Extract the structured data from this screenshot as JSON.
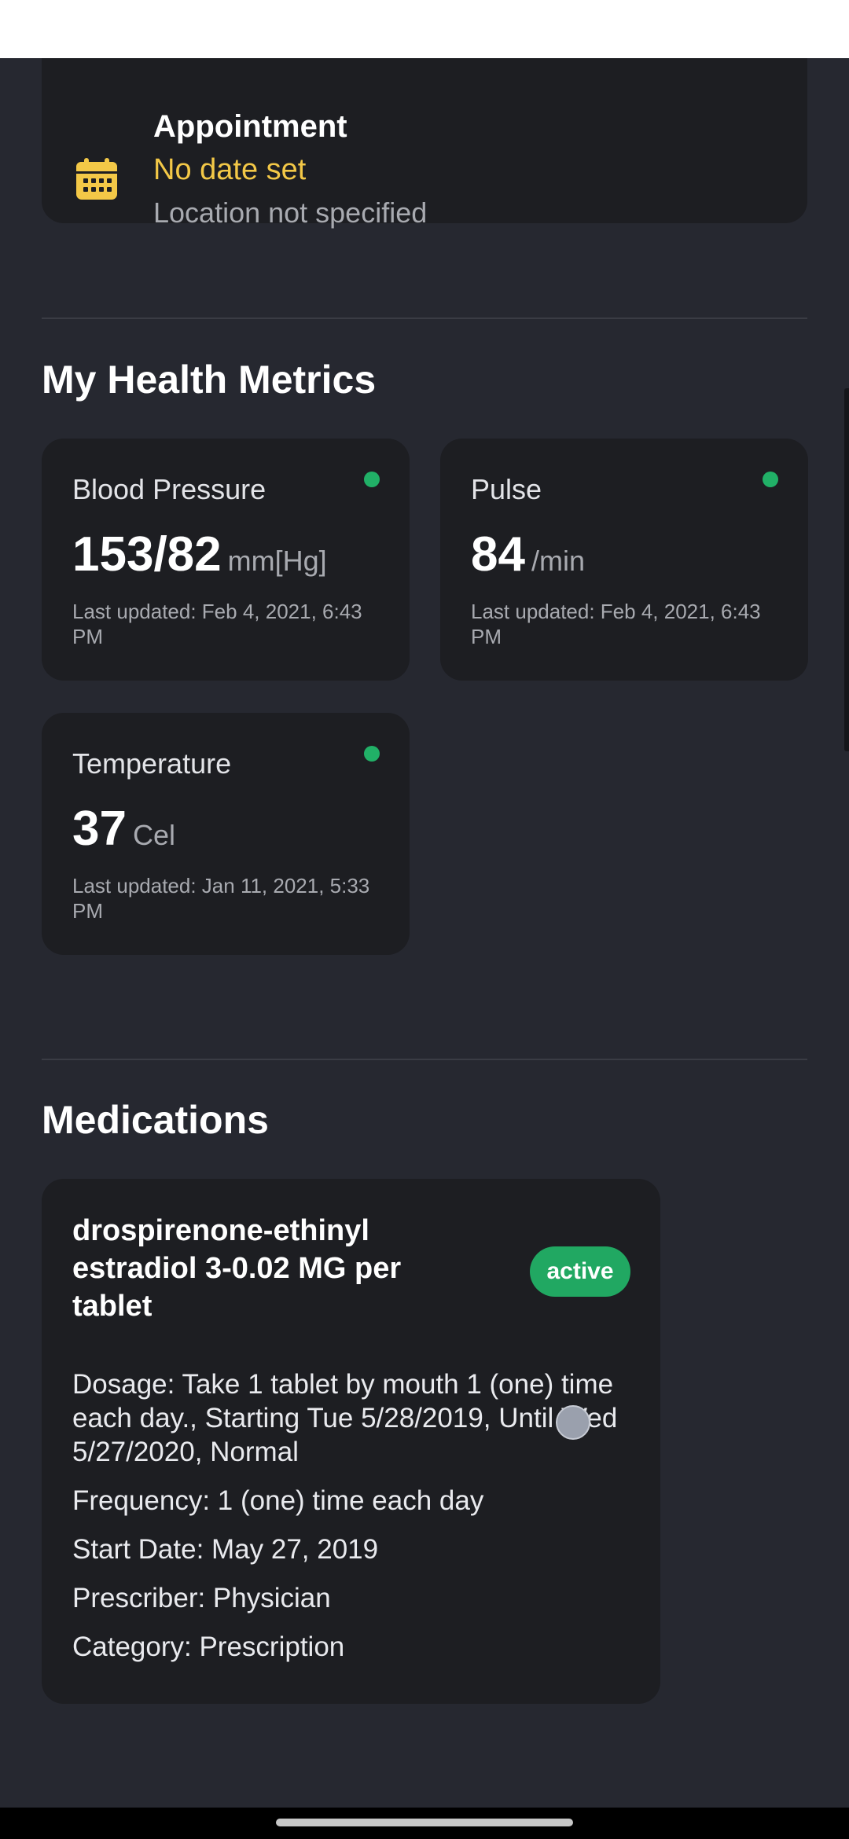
{
  "appointment": {
    "title": "Appointment",
    "date": "No date set",
    "location": "Location not specified",
    "icon": "calendar-icon",
    "date_color": "#f3c847"
  },
  "health_metrics": {
    "section_title": "My Health Metrics",
    "status_color": "#21b067",
    "items": [
      {
        "name": "Blood Pressure",
        "value": "153/82",
        "unit": "mm[Hg]",
        "updated": "Last updated: Feb 4, 2021, 6:43 PM"
      },
      {
        "name": "Pulse",
        "value": "84",
        "unit": "/min",
        "updated": "Last updated: Feb 4, 2021, 6:43 PM"
      },
      {
        "name": "Temperature",
        "value": "37",
        "unit": "Cel",
        "updated": "Last updated: Jan 11, 2021, 5:33 PM"
      }
    ]
  },
  "medications": {
    "section_title": "Medications",
    "items": [
      {
        "name": "drospirenone-ethinyl estradiol 3-0.02 MG per tablet",
        "status": "active",
        "status_color": "#21a862",
        "dosage": "Dosage: Take 1 tablet by mouth 1 (one) time each day., Starting Tue 5/28/2019, Until Wed 5/27/2020, Normal",
        "frequency": "Frequency: 1 (one) time each day",
        "start_date": "Start Date: May 27, 2019",
        "prescriber": "Prescriber: Physician",
        "category": "Category: Prescription"
      }
    ]
  },
  "theme": {
    "background": "#262830",
    "card": "#1d1e22"
  }
}
